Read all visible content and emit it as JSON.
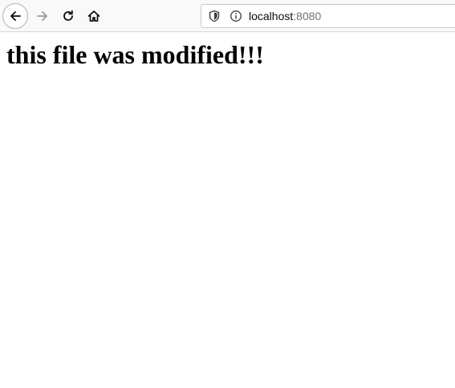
{
  "toolbar": {
    "back_icon": "arrow-left-icon",
    "forward_icon": "arrow-right-icon",
    "reload_icon": "reload-icon",
    "home_icon": "home-icon"
  },
  "urlbar": {
    "host": "localhost",
    "port": ":8080",
    "tracking_icon": "shield-icon",
    "info_icon": "info-icon"
  },
  "page": {
    "heading": "this file was modified!!!"
  }
}
